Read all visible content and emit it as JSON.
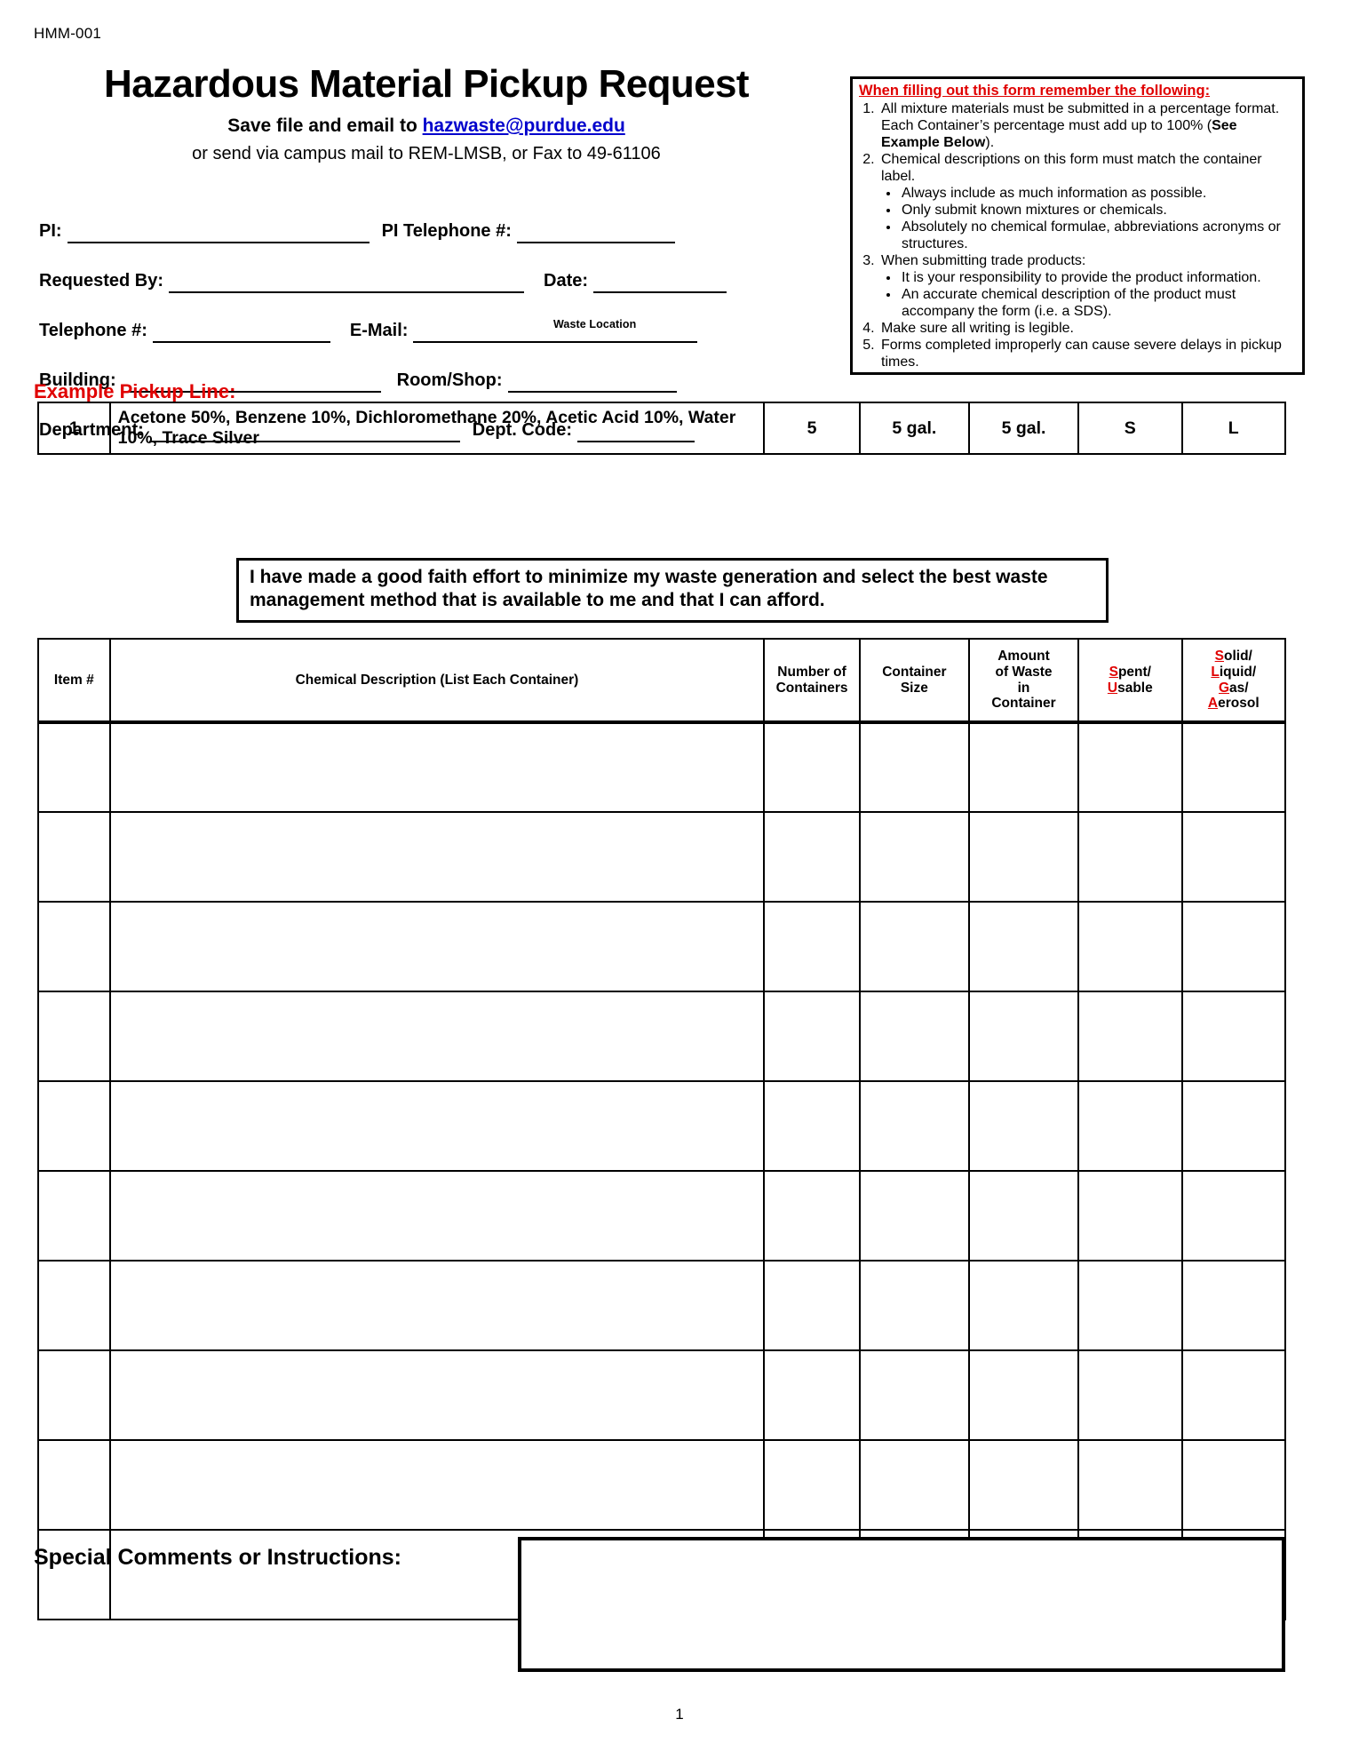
{
  "form_code": "HMM-001",
  "header": {
    "title": "Hazardous Material Pickup Request",
    "subtitle_prefix": "Save file and email to ",
    "email": "hazwaste@purdue.edu",
    "subtitle_2": "or send via campus mail to REM-LMSB, or Fax to 49-61106"
  },
  "instructions": {
    "heading": "When filling out this form remember the following:",
    "item1_a": "All mixture materials must be submitted in a percentage format.  Each Container’s percentage must add up to 100% (",
    "item1_bold": "See Example Below",
    "item1_b": ").",
    "item2": "Chemical descriptions on this form must match the container label.",
    "item2_bullets": [
      "Always include as much information as possible.",
      "Only submit known mixtures or chemicals.",
      "Absolutely no chemical formulae, abbreviations acronyms or structures."
    ],
    "item3": "When submitting trade products:",
    "item3_bullets": [
      "It is your responsibility to provide the product information.",
      "An accurate chemical description of the product must accompany the form (i.e. a SDS)."
    ],
    "item4": "Make sure all writing is legible.",
    "item5": "Forms completed improperly can cause severe delays in pickup times."
  },
  "fields": {
    "pi": "PI:",
    "pi_telephone": "PI Telephone #:",
    "requested_by": "Requested By:",
    "date": "Date:",
    "telephone": "Telephone #:",
    "email": "E-Mail:",
    "building": "Building:",
    "room_shop": "Room/Shop:",
    "waste_location_note": "Waste Location",
    "department": "Department:",
    "dept_code": "Dept. Code:",
    "values": {
      "pi": "",
      "pi_telephone": "",
      "requested_by": "",
      "date": "",
      "telephone": "",
      "email": "",
      "building": "",
      "room_shop": "",
      "department": "",
      "dept_code": ""
    }
  },
  "example": {
    "label": "Example Pickup Line:",
    "row": {
      "item": "1",
      "description": "Acetone 50%, Benzene 10%, Dichloromethane 20%, Acetic Acid 10%, Water 10%, Trace Silver",
      "number_of_containers": "5",
      "container_size": "5 gal.",
      "amount_of_waste": "5 gal.",
      "spent_usable": "S",
      "solid_liquid_gas_aerosol": "L"
    }
  },
  "good_faith_statement": "I have made a good faith effort to minimize my waste generation and select the best waste management method that is available to me and that I can afford.",
  "main_table": {
    "headers": {
      "item": "Item #",
      "description": "Chemical Description (List Each Container)",
      "number_of_containers_l1": "Number of",
      "number_of_containers_l2": "Containers",
      "container_size_l1": "Container",
      "container_size_l2": "Size",
      "amount_l1": "Amount",
      "amount_l2": "of Waste",
      "amount_l3": "in",
      "amount_l4": "Container",
      "spent_usable_hot1": "S",
      "spent_usable_rest1": "pent/",
      "spent_usable_hot2": "U",
      "spent_usable_rest2": "sable",
      "slga_hot1": "S",
      "slga_rest1": "olid/",
      "slga_hot2": "L",
      "slga_rest2": "iquid/",
      "slga_hot3": "G",
      "slga_rest3": "as/",
      "slga_hot4": "A",
      "slga_rest4": "erosol"
    },
    "rows": [
      {
        "item": "",
        "description": "",
        "number_of_containers": "",
        "container_size": "",
        "amount": "",
        "spent_usable": "",
        "slga": ""
      },
      {
        "item": "",
        "description": "",
        "number_of_containers": "",
        "container_size": "",
        "amount": "",
        "spent_usable": "",
        "slga": ""
      },
      {
        "item": "",
        "description": "",
        "number_of_containers": "",
        "container_size": "",
        "amount": "",
        "spent_usable": "",
        "slga": ""
      },
      {
        "item": "",
        "description": "",
        "number_of_containers": "",
        "container_size": "",
        "amount": "",
        "spent_usable": "",
        "slga": ""
      },
      {
        "item": "",
        "description": "",
        "number_of_containers": "",
        "container_size": "",
        "amount": "",
        "spent_usable": "",
        "slga": ""
      },
      {
        "item": "",
        "description": "",
        "number_of_containers": "",
        "container_size": "",
        "amount": "",
        "spent_usable": "",
        "slga": ""
      },
      {
        "item": "",
        "description": "",
        "number_of_containers": "",
        "container_size": "",
        "amount": "",
        "spent_usable": "",
        "slga": ""
      },
      {
        "item": "",
        "description": "",
        "number_of_containers": "",
        "container_size": "",
        "amount": "",
        "spent_usable": "",
        "slga": ""
      },
      {
        "item": "",
        "description": "",
        "number_of_containers": "",
        "container_size": "",
        "amount": "",
        "spent_usable": "",
        "slga": ""
      },
      {
        "item": "",
        "description": "",
        "number_of_containers": "",
        "container_size": "",
        "amount": "",
        "spent_usable": "",
        "slga": ""
      }
    ]
  },
  "comments": {
    "label": "Special Comments or Instructions:",
    "value": ""
  },
  "page_number": "1",
  "colors": {
    "accent_red": "#E00000",
    "link_blue": "#0000CC",
    "ink": "#000000"
  }
}
